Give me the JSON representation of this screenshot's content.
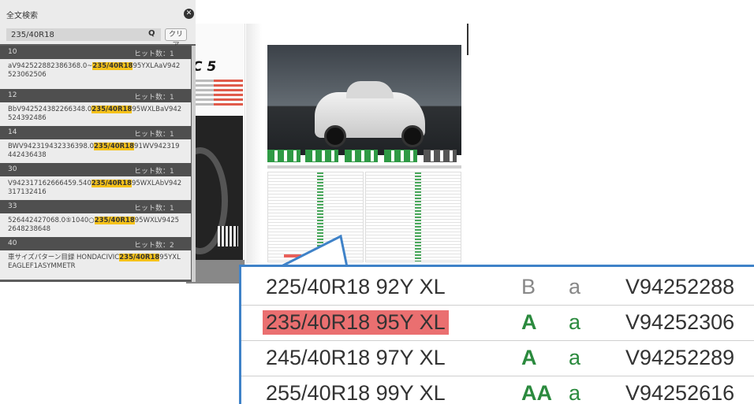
{
  "search_panel": {
    "title": "全文検索",
    "query": "235/40R18",
    "clear_label": "クリア",
    "results": [
      {
        "page": "10",
        "hits": "ヒット数：1",
        "pre": "aV942522882386368.0~",
        "match": "235/40R18",
        "post": "95YXLAaV942523062506"
      },
      {
        "page": "12",
        "hits": "ヒット数：1",
        "pre": "BbV942524382266348.0",
        "match": "235/40R18",
        "post": "95WXLBaV942524392486"
      },
      {
        "page": "14",
        "hits": "ヒット数：1",
        "pre": "BWV942319432336398.0",
        "match": "235/40R18",
        "post": "91WV942319442436438"
      },
      {
        "page": "30",
        "hits": "ヒット数：1",
        "pre": "V942317162666459.540",
        "match": "235/40R18",
        "post": "95WXLAbV942317132416"
      },
      {
        "page": "33",
        "hits": "ヒット数：1",
        "pre": "526442427068.0⑤1040○",
        "match": "235/40R18",
        "post": "95WXLV94252648238648"
      },
      {
        "page": "40",
        "hits": "ヒット数：2",
        "pre": "車サイズパターン目録 HONDACIVIC",
        "match": "235/40R18",
        "post": "95YXLEAGLEF1ASYMMETR"
      }
    ]
  },
  "catalog": {
    "model_label": "C 5"
  },
  "zoom": {
    "rows": [
      {
        "size": "225/40R18 92Y XL",
        "grade": "B",
        "wet": "a",
        "code": "V94252288",
        "highlight": false
      },
      {
        "size": "235/40R18 95Y XL",
        "grade": "A",
        "wet": "a",
        "code": "V94252306",
        "highlight": true
      },
      {
        "size": "245/40R18 97Y XL",
        "grade": "A",
        "wet": "a",
        "code": "V94252289",
        "highlight": false
      },
      {
        "size": "255/40R18 99Y XL",
        "grade": "AA",
        "wet": "a",
        "code": "V94252616",
        "highlight": false
      }
    ]
  }
}
